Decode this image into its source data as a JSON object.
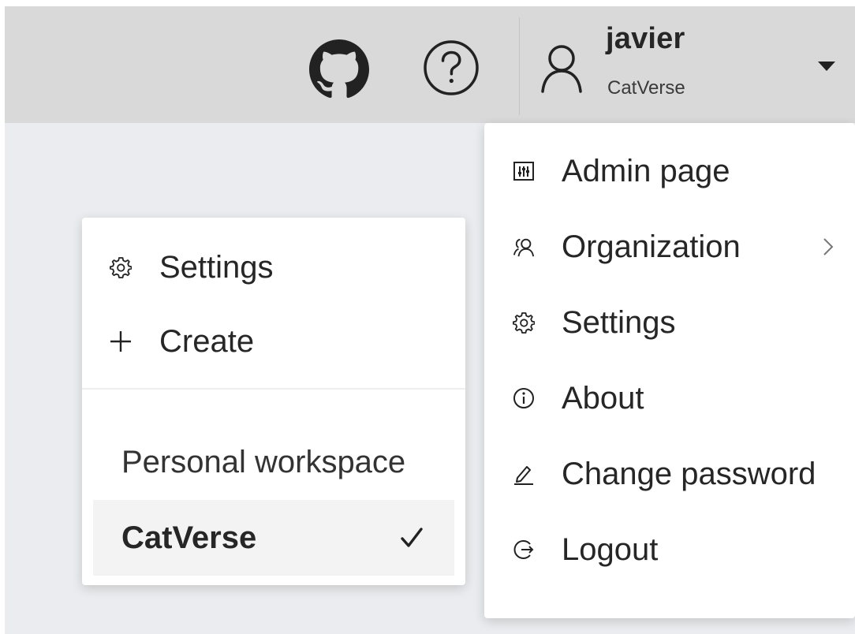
{
  "header": {
    "icons": {
      "github": "github-icon",
      "help": "help-icon",
      "user": "user-icon",
      "caret": "caret-down-icon"
    },
    "user_name": "javier",
    "organization": "CatVerse"
  },
  "user_menu": {
    "items": [
      {
        "label": "Admin page",
        "icon": "admin-panel-icon"
      },
      {
        "label": "Organization",
        "icon": "team-icon",
        "has_submenu": true
      },
      {
        "label": "Settings",
        "icon": "gear-icon"
      },
      {
        "label": "About",
        "icon": "info-icon"
      },
      {
        "label": "Change password",
        "icon": "pencil-icon"
      },
      {
        "label": "Logout",
        "icon": "logout-icon"
      }
    ]
  },
  "organization_submenu": {
    "actions": [
      {
        "label": "Settings",
        "icon": "gear-icon"
      },
      {
        "label": "Create",
        "icon": "plus-icon"
      }
    ],
    "workspaces": [
      {
        "label": "Personal workspace",
        "selected": false
      },
      {
        "label": "CatVerse",
        "selected": true
      }
    ]
  },
  "colors": {
    "header_bg": "#d9d9d9",
    "content_bg": "#eaecef",
    "menu_bg": "#ffffff",
    "selected_bg": "#f3f3f3",
    "text": "#262626"
  }
}
